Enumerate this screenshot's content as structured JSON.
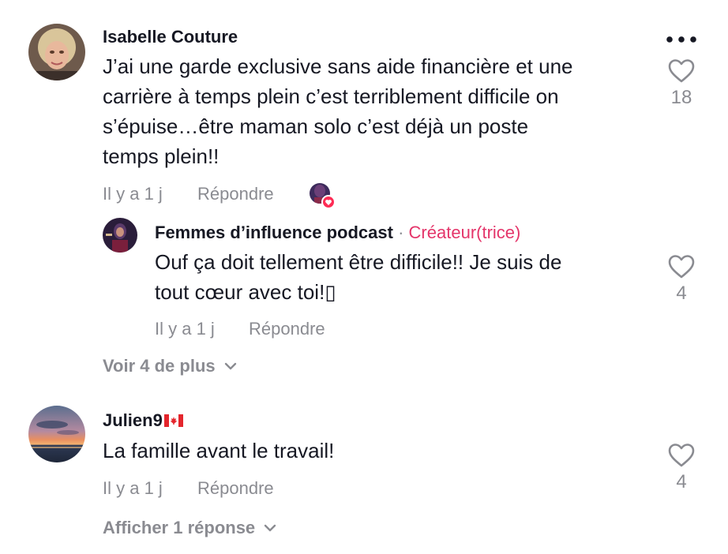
{
  "comments": [
    {
      "username": "Isabelle Couture",
      "lines": [
        "J’ai une garde exclusive sans aide financière et une",
        "carrière à temps plein c’est terriblement difficile on",
        "s’épuise…être maman solo c’est déjà un poste",
        "temps plein!!"
      ],
      "time": "Il y a 1 j",
      "reply_label": "Répondre",
      "likes": "18",
      "more_icon": "more-horizontal-icon",
      "liked_by_creator_icon": "creator-heart-badge"
    },
    {
      "username": "Julien9",
      "flag_icon": "canada-flag-icon",
      "lines": [
        "La famille avant le travail!"
      ],
      "time": "Il y a 1 j",
      "reply_label": "Répondre",
      "likes": "4"
    }
  ],
  "reply": {
    "username": "Femmes d’influence podcast",
    "separator": "·",
    "creator_label": "Créateur(trice)",
    "lines": [
      "Ouf ça doit tellement être difficile!! Je suis de",
      "tout cœur avec toi!▯"
    ],
    "time": "Il y a 1 j",
    "reply_label": "Répondre",
    "likes": "4"
  },
  "view_more_1": "Voir 4 de plus",
  "view_more_2": "Afficher 1 réponse",
  "colors": {
    "text": "#161823",
    "secondary": "#8a8b91",
    "creator_accent": "#e4356a"
  }
}
